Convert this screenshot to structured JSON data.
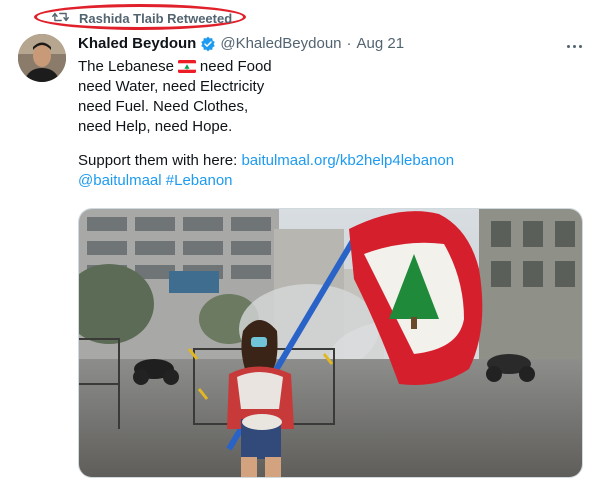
{
  "retweet": {
    "text": "Rashida Tlaib Retweeted",
    "icon": "retweet-icon"
  },
  "tweet": {
    "author_name": "Khaled Beydoun",
    "handle": "@KhaledBeydoun",
    "separator": "·",
    "date": "Aug 21",
    "verified": true,
    "lines": [
      "The Lebanese",
      "need Food",
      "need Water, need Electricity",
      "need Fuel. Need Clothes,",
      "need Help, need Hope."
    ],
    "support_text": "Support them with here:",
    "support_link": "baitulmaal.org/kb2help4lebanon",
    "mention": "@baitulmaal",
    "hashtag": "#Lebanon"
  },
  "colors": {
    "accent": "#1d9bf0",
    "muted": "#536471",
    "highlight": "#e0202a"
  }
}
